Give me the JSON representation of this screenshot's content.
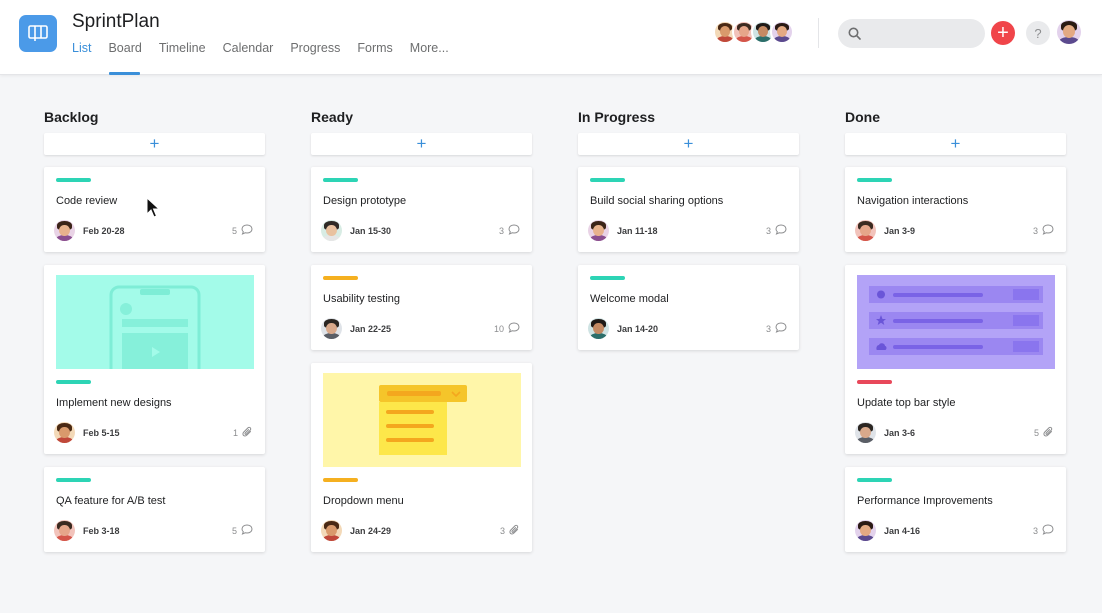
{
  "app": {
    "title": "SprintPlan",
    "tabs": [
      "List",
      "Board",
      "Timeline",
      "Calendar",
      "Progress",
      "Forms",
      "More..."
    ],
    "active_tab": "List",
    "accent": "#3a8fd9",
    "add_button": "+",
    "help_button": "?"
  },
  "columns": [
    {
      "title": "Backlog",
      "add_label": "+",
      "cards": [
        {
          "title": "Code review",
          "date": "Feb 20-28",
          "count": "5",
          "count_icon": "comment-icon",
          "tag": "#2dd4b5",
          "avatar": "female-1"
        },
        {
          "title": "Implement new designs",
          "date": "Feb 5-15",
          "count": "1",
          "count_icon": "attachment-icon",
          "tag": "#2dd4b5",
          "avatar": "female-2",
          "thumb": "phone-mockup"
        },
        {
          "title": "QA feature for A/B test",
          "date": "Feb 3-18",
          "count": "5",
          "count_icon": "comment-icon",
          "tag": "#2dd4b5",
          "avatar": "male-1"
        }
      ]
    },
    {
      "title": "Ready",
      "add_label": "+",
      "cards": [
        {
          "title": "Design prototype",
          "date": "Jan 15-30",
          "count": "3",
          "count_icon": "comment-icon",
          "tag": "#2dd4b5",
          "avatar": "male-2"
        },
        {
          "title": "Usability testing",
          "date": "Jan 22-25",
          "count": "10",
          "count_icon": "comment-icon",
          "tag": "#f5b020",
          "avatar": "male-3"
        },
        {
          "title": "Dropdown menu",
          "date": "Jan 24-29",
          "count": "3",
          "count_icon": "attachment-icon",
          "tag": "#f5b020",
          "avatar": "female-2",
          "thumb": "dropdown-mockup"
        }
      ]
    },
    {
      "title": "In Progress",
      "add_label": "+",
      "cards": [
        {
          "title": "Build social sharing options",
          "date": "Jan 11-18",
          "count": "3",
          "count_icon": "comment-icon",
          "tag": "#2dd4b5",
          "avatar": "female-1"
        },
        {
          "title": "Welcome modal",
          "date": "Jan 14-20",
          "count": "3",
          "count_icon": "comment-icon",
          "tag": "#2dd4b5",
          "avatar": "male-4"
        }
      ]
    },
    {
      "title": "Done",
      "add_label": "+",
      "cards": [
        {
          "title": "Navigation interactions",
          "date": "Jan 3-9",
          "count": "3",
          "count_icon": "comment-icon",
          "tag": "#2dd4b5",
          "avatar": "male-1"
        },
        {
          "title": "Update top bar style",
          "date": "Jan 3-6",
          "count": "5",
          "count_icon": "attachment-icon",
          "tag": "#e8485a",
          "avatar": "male-3",
          "thumb": "list-mockup"
        },
        {
          "title": "Performance Improvements",
          "date": "Jan 4-16",
          "count": "3",
          "count_icon": "comment-icon",
          "tag": "#2dd4b5",
          "avatar": "female-3"
        }
      ]
    }
  ]
}
